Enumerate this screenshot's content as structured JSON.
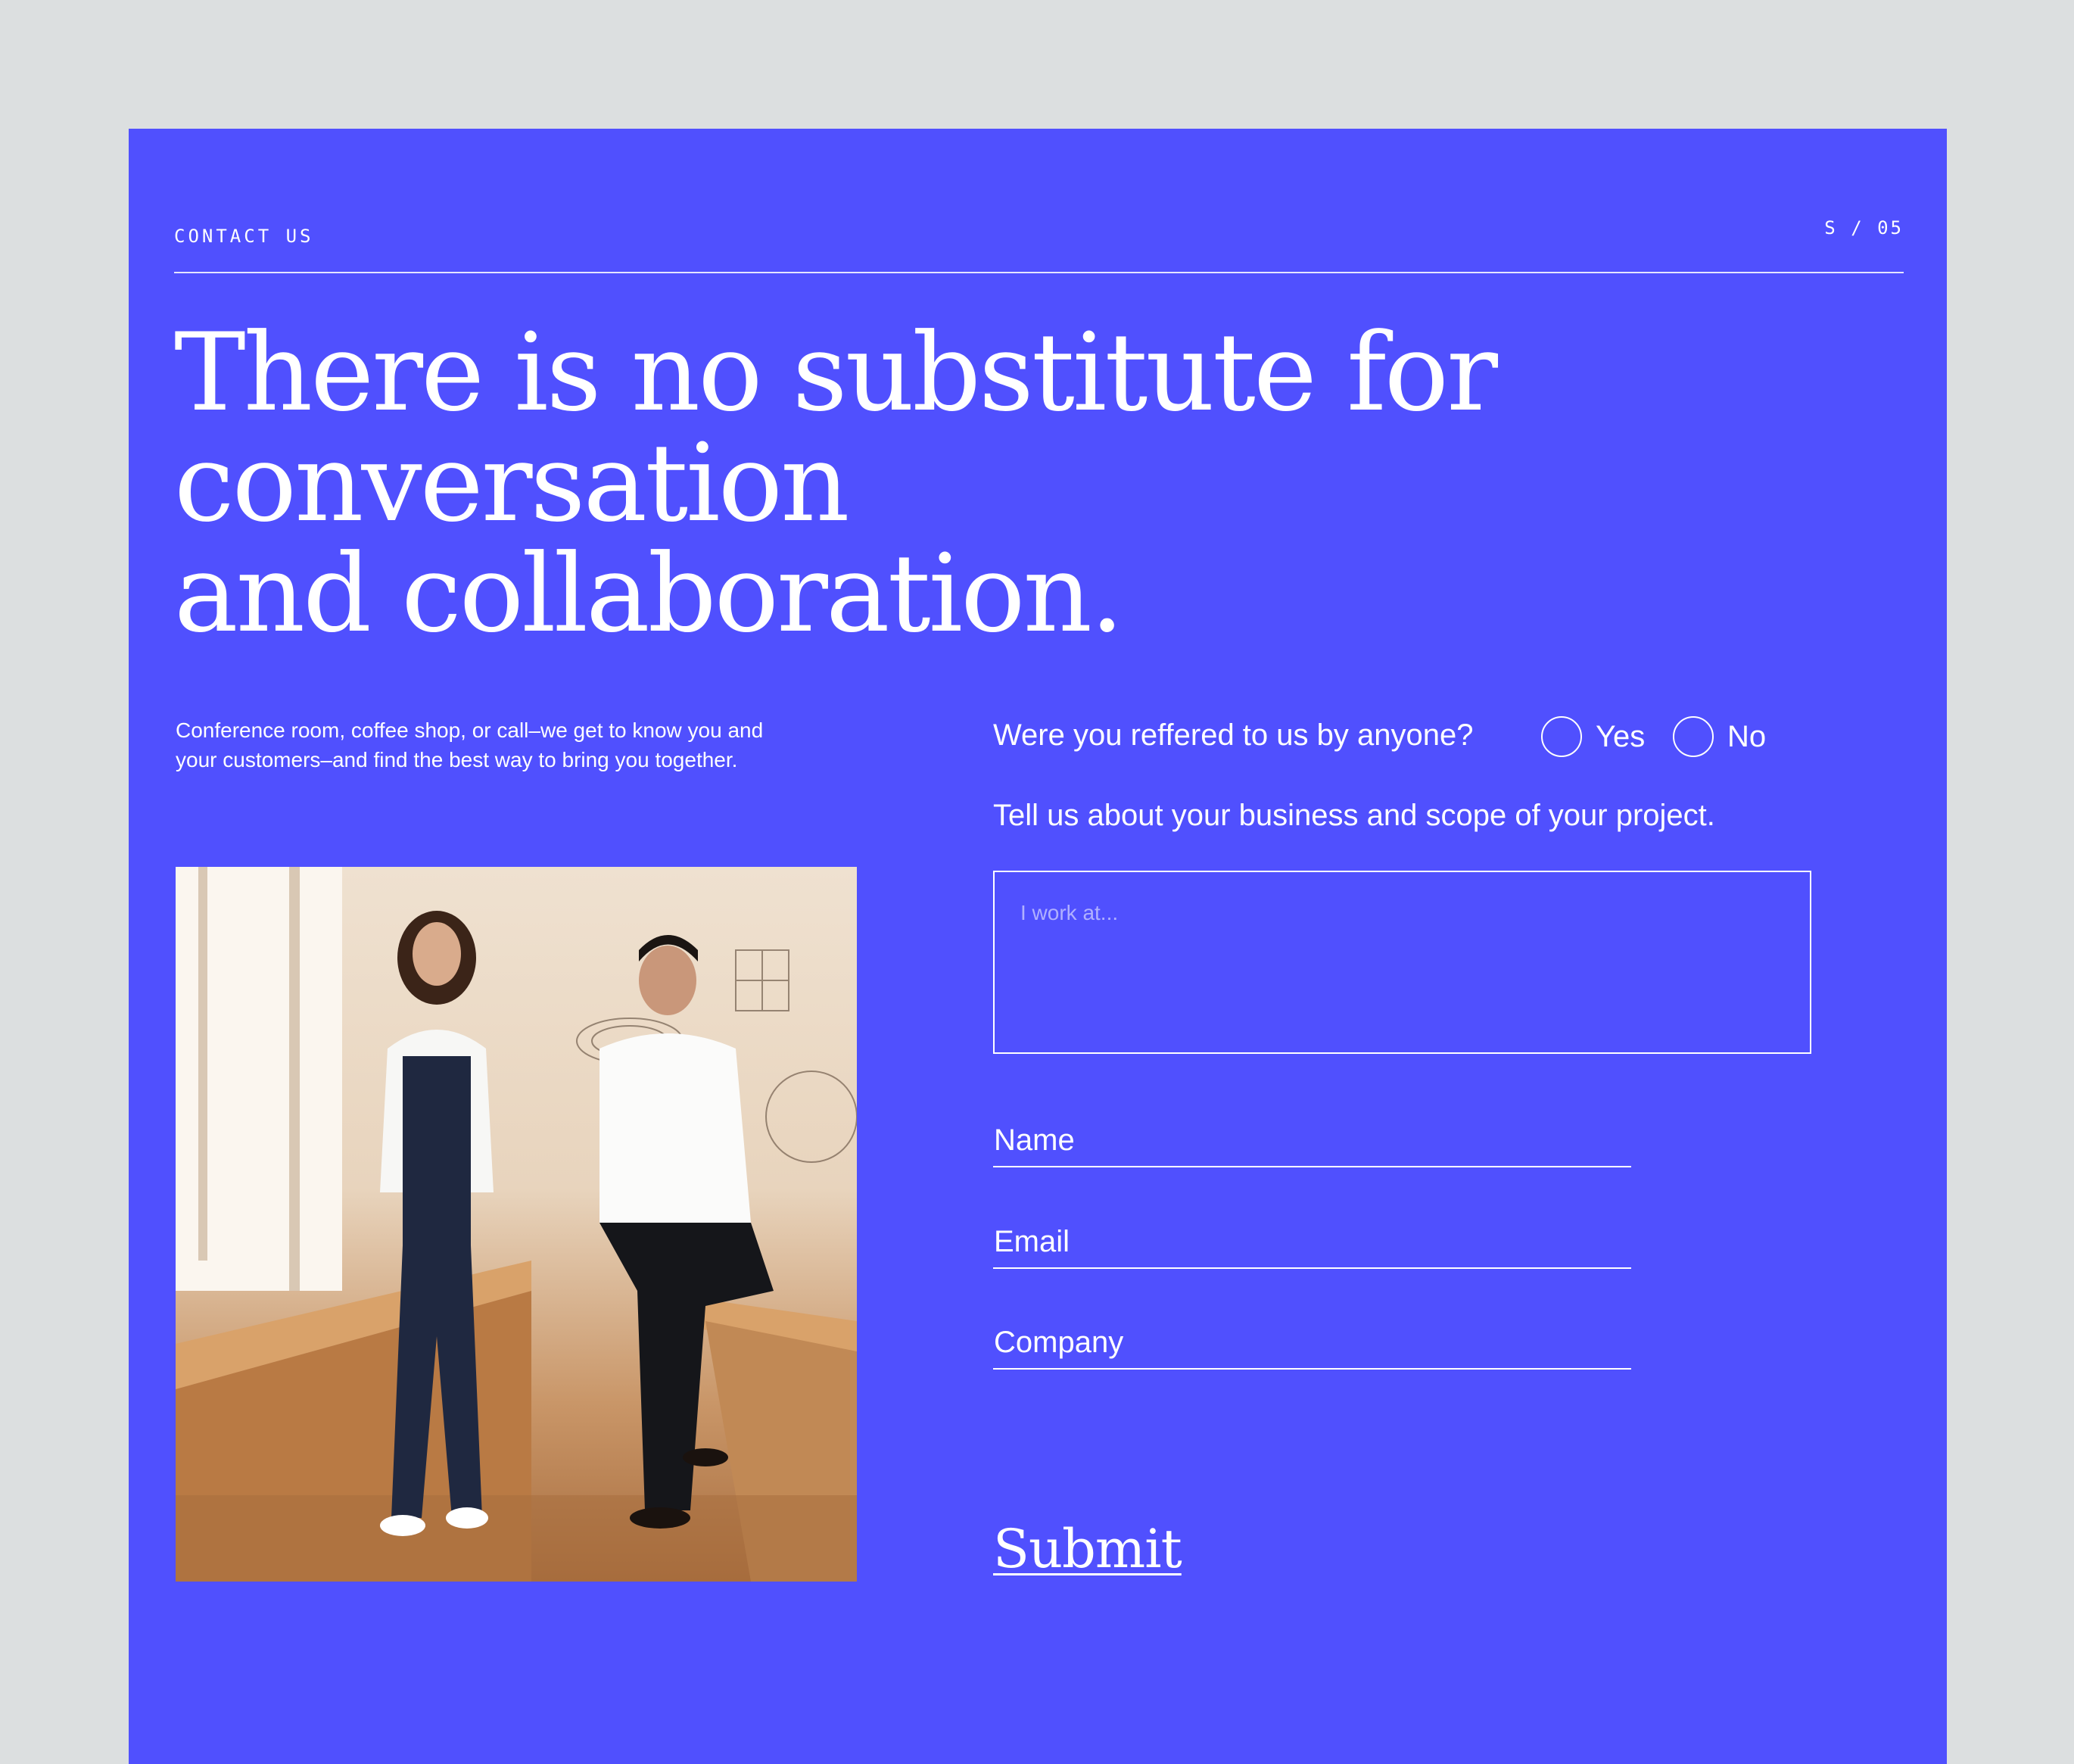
{
  "header": {
    "eyebrow": "CONTACT US",
    "slide_indicator": "S / 05"
  },
  "hero": {
    "headline_line1": "There is no substitute for conversation",
    "headline_line2": "and collaboration."
  },
  "intro": {
    "text_line1": "Conference room, coffee shop, or call–we get to know you and",
    "text_line2": "your customers–and find the best way to bring you together."
  },
  "photo": {
    "description_icon": "photo-two-people-studio"
  },
  "form": {
    "referral_question": "Were you reffered to us by anyone?",
    "referral_options": [
      "Yes",
      "No"
    ],
    "scope_prompt": "Tell us about your business and scope of your project.",
    "scope_placeholder": "I work at...",
    "name_placeholder": "Name",
    "email_placeholder": "Email",
    "company_placeholder": "Company",
    "submit_label": "Submit"
  },
  "colors": {
    "page_background": "#dcdfe0",
    "panel_background": "#5050fe",
    "foreground": "#ffffff"
  }
}
